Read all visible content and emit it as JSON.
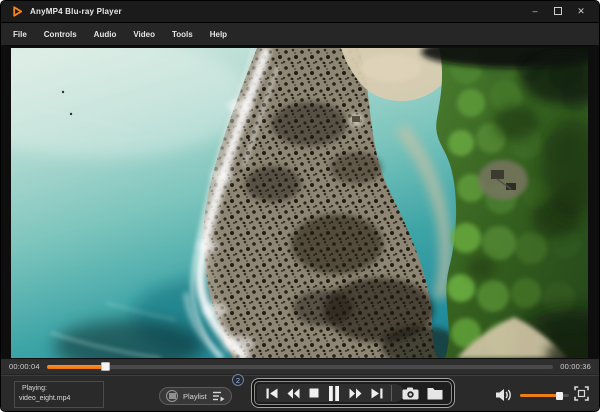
{
  "window": {
    "title": "AnyMP4 Blu-ray Player",
    "controls": {
      "minimize": "–",
      "close": "✕"
    }
  },
  "menu": {
    "items": [
      "File",
      "Controls",
      "Audio",
      "Video",
      "Tools",
      "Help"
    ]
  },
  "video": {
    "description": "Aerial drone view of turquoise sea with white surf breaking on a rocky shore, a sandy beach strip and dense green tropical forest"
  },
  "progress": {
    "elapsed": "00:00:04",
    "remaining": "00:00:36",
    "percent": 11.5
  },
  "now_playing": {
    "label": "Playing:",
    "filename": "video_eight.mp4"
  },
  "playlist": {
    "label": "Playlist",
    "count_badge": "2"
  },
  "transport": {
    "buttons": [
      "previous",
      "rewind",
      "stop",
      "pause",
      "fast-forward",
      "next"
    ],
    "extras": [
      "snapshot",
      "open-folder"
    ]
  },
  "volume": {
    "percent": 80
  },
  "icons": {
    "app-logo": "orange play triangle",
    "playlist-menu": "hamburger lines",
    "playlist-add": "list with play triangle",
    "snapshot": "camera",
    "open-folder": "folder",
    "volume": "speaker with waves",
    "fullscreen": "corner brackets"
  },
  "colors": {
    "accent": "#ef7d17",
    "titlebar_bg": "#1b1b1b",
    "menu_bg": "#262626",
    "panel_bg": "#2a2a2a"
  }
}
